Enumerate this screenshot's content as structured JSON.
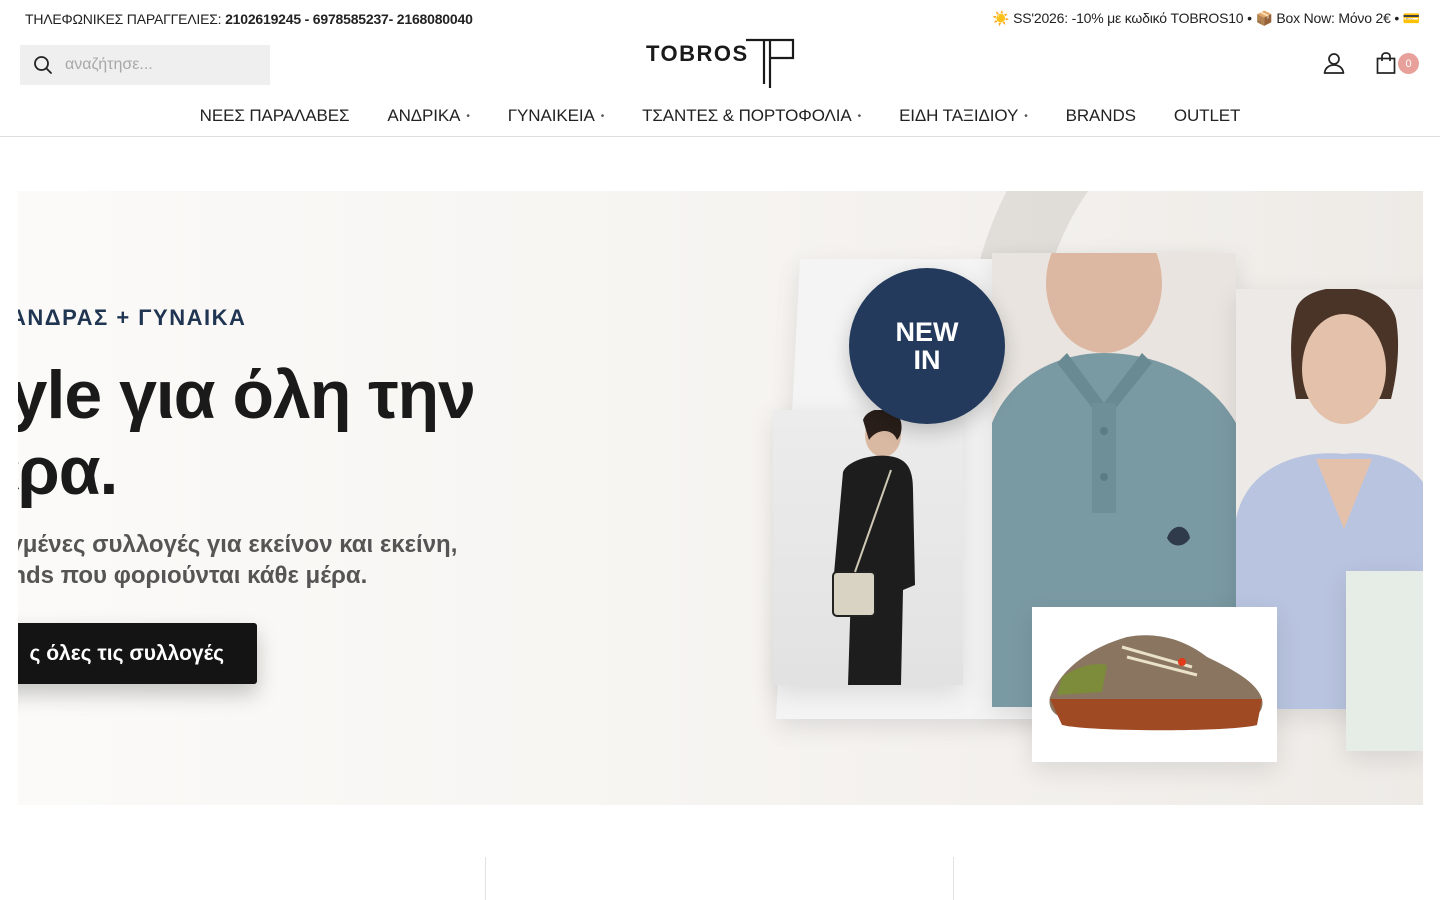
{
  "topbar": {
    "phones_label": "ΤΗΛΕΦΩΝΙΚΕΣ ΠΑΡΑΓΓΕΛΙΕΣ:",
    "phones_numbers": "2102619245 - 6978585237- 2168080040",
    "promo": "☀️ SS'2026: -10% με κωδικό TOBROS10 • 📦 Box Now: Μόνο 2€ • 💳"
  },
  "header": {
    "search_placeholder": "αναζήτησε...",
    "logo_text": "TOBROS",
    "cart_count": "0"
  },
  "nav": {
    "items": [
      {
        "label": "ΝΕΕΣ ΠΑΡΑΛΑΒΕΣ",
        "dropdown": false
      },
      {
        "label": "ΑΝΔΡΙΚΑ",
        "dropdown": true
      },
      {
        "label": "ΓΥΝΑΙΚΕΙΑ",
        "dropdown": true
      },
      {
        "label": "ΤΣΑΝΤΕΣ & ΠΟΡΤΟΦΟΛΙΑ",
        "dropdown": true
      },
      {
        "label": "ΕΙΔΗ ΤΑΞΙΔΙΟΥ",
        "dropdown": true
      },
      {
        "label": "BRANDS",
        "dropdown": false
      },
      {
        "label": "OUTLET",
        "dropdown": false
      }
    ],
    "dropdown_marker": "•"
  },
  "hero": {
    "eyebrow": "ΑΝΔΡΑΣ + ΓΥΝΑΙΚΑ",
    "title_line1": "tyle για όλη την",
    "title_line2": "έρα.",
    "subtitle_line1": "εγμένες συλλογές για εκείνον και εκείνη,",
    "subtitle_line2": "ands που φοριούνται κάθε μέρα.",
    "cta": "ς όλες τις συλλογές",
    "badge_line1": "NEW",
    "badge_line2": "IN"
  },
  "colors": {
    "navy": "#233a5c",
    "cart_badge": "#e8a09a",
    "cta_bg": "#141414",
    "polo": "#7a9aa3"
  }
}
